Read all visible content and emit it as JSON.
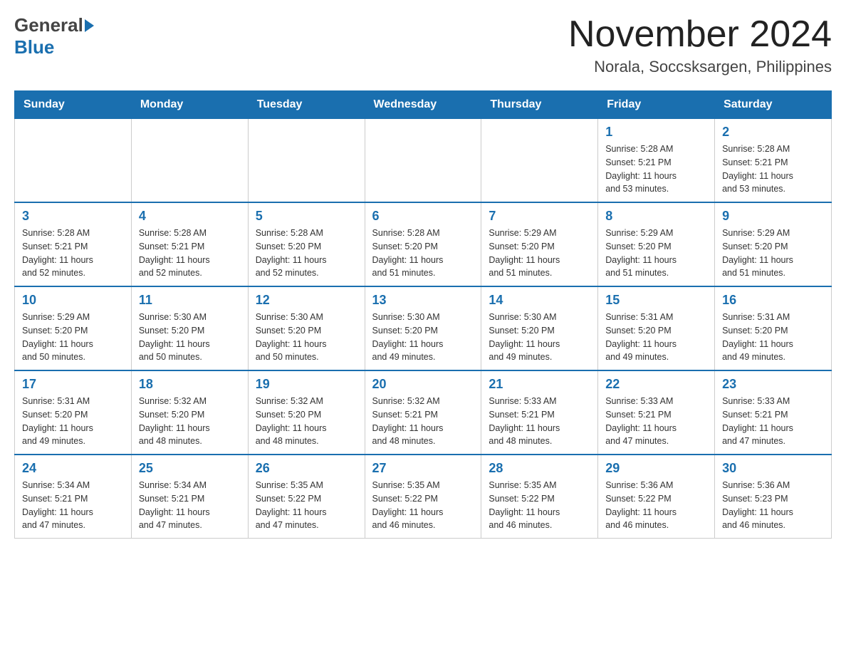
{
  "header": {
    "logo_general": "General",
    "logo_blue": "Blue",
    "title": "November 2024",
    "location": "Norala, Soccsksargen, Philippines"
  },
  "days_of_week": [
    "Sunday",
    "Monday",
    "Tuesday",
    "Wednesday",
    "Thursday",
    "Friday",
    "Saturday"
  ],
  "weeks": [
    {
      "cells": [
        {
          "day": "",
          "info": ""
        },
        {
          "day": "",
          "info": ""
        },
        {
          "day": "",
          "info": ""
        },
        {
          "day": "",
          "info": ""
        },
        {
          "day": "",
          "info": ""
        },
        {
          "day": "1",
          "info": "Sunrise: 5:28 AM\nSunset: 5:21 PM\nDaylight: 11 hours\nand 53 minutes."
        },
        {
          "day": "2",
          "info": "Sunrise: 5:28 AM\nSunset: 5:21 PM\nDaylight: 11 hours\nand 53 minutes."
        }
      ]
    },
    {
      "cells": [
        {
          "day": "3",
          "info": "Sunrise: 5:28 AM\nSunset: 5:21 PM\nDaylight: 11 hours\nand 52 minutes."
        },
        {
          "day": "4",
          "info": "Sunrise: 5:28 AM\nSunset: 5:21 PM\nDaylight: 11 hours\nand 52 minutes."
        },
        {
          "day": "5",
          "info": "Sunrise: 5:28 AM\nSunset: 5:20 PM\nDaylight: 11 hours\nand 52 minutes."
        },
        {
          "day": "6",
          "info": "Sunrise: 5:28 AM\nSunset: 5:20 PM\nDaylight: 11 hours\nand 51 minutes."
        },
        {
          "day": "7",
          "info": "Sunrise: 5:29 AM\nSunset: 5:20 PM\nDaylight: 11 hours\nand 51 minutes."
        },
        {
          "day": "8",
          "info": "Sunrise: 5:29 AM\nSunset: 5:20 PM\nDaylight: 11 hours\nand 51 minutes."
        },
        {
          "day": "9",
          "info": "Sunrise: 5:29 AM\nSunset: 5:20 PM\nDaylight: 11 hours\nand 51 minutes."
        }
      ]
    },
    {
      "cells": [
        {
          "day": "10",
          "info": "Sunrise: 5:29 AM\nSunset: 5:20 PM\nDaylight: 11 hours\nand 50 minutes."
        },
        {
          "day": "11",
          "info": "Sunrise: 5:30 AM\nSunset: 5:20 PM\nDaylight: 11 hours\nand 50 minutes."
        },
        {
          "day": "12",
          "info": "Sunrise: 5:30 AM\nSunset: 5:20 PM\nDaylight: 11 hours\nand 50 minutes."
        },
        {
          "day": "13",
          "info": "Sunrise: 5:30 AM\nSunset: 5:20 PM\nDaylight: 11 hours\nand 49 minutes."
        },
        {
          "day": "14",
          "info": "Sunrise: 5:30 AM\nSunset: 5:20 PM\nDaylight: 11 hours\nand 49 minutes."
        },
        {
          "day": "15",
          "info": "Sunrise: 5:31 AM\nSunset: 5:20 PM\nDaylight: 11 hours\nand 49 minutes."
        },
        {
          "day": "16",
          "info": "Sunrise: 5:31 AM\nSunset: 5:20 PM\nDaylight: 11 hours\nand 49 minutes."
        }
      ]
    },
    {
      "cells": [
        {
          "day": "17",
          "info": "Sunrise: 5:31 AM\nSunset: 5:20 PM\nDaylight: 11 hours\nand 49 minutes."
        },
        {
          "day": "18",
          "info": "Sunrise: 5:32 AM\nSunset: 5:20 PM\nDaylight: 11 hours\nand 48 minutes."
        },
        {
          "day": "19",
          "info": "Sunrise: 5:32 AM\nSunset: 5:20 PM\nDaylight: 11 hours\nand 48 minutes."
        },
        {
          "day": "20",
          "info": "Sunrise: 5:32 AM\nSunset: 5:21 PM\nDaylight: 11 hours\nand 48 minutes."
        },
        {
          "day": "21",
          "info": "Sunrise: 5:33 AM\nSunset: 5:21 PM\nDaylight: 11 hours\nand 48 minutes."
        },
        {
          "day": "22",
          "info": "Sunrise: 5:33 AM\nSunset: 5:21 PM\nDaylight: 11 hours\nand 47 minutes."
        },
        {
          "day": "23",
          "info": "Sunrise: 5:33 AM\nSunset: 5:21 PM\nDaylight: 11 hours\nand 47 minutes."
        }
      ]
    },
    {
      "cells": [
        {
          "day": "24",
          "info": "Sunrise: 5:34 AM\nSunset: 5:21 PM\nDaylight: 11 hours\nand 47 minutes."
        },
        {
          "day": "25",
          "info": "Sunrise: 5:34 AM\nSunset: 5:21 PM\nDaylight: 11 hours\nand 47 minutes."
        },
        {
          "day": "26",
          "info": "Sunrise: 5:35 AM\nSunset: 5:22 PM\nDaylight: 11 hours\nand 47 minutes."
        },
        {
          "day": "27",
          "info": "Sunrise: 5:35 AM\nSunset: 5:22 PM\nDaylight: 11 hours\nand 46 minutes."
        },
        {
          "day": "28",
          "info": "Sunrise: 5:35 AM\nSunset: 5:22 PM\nDaylight: 11 hours\nand 46 minutes."
        },
        {
          "day": "29",
          "info": "Sunrise: 5:36 AM\nSunset: 5:22 PM\nDaylight: 11 hours\nand 46 minutes."
        },
        {
          "day": "30",
          "info": "Sunrise: 5:36 AM\nSunset: 5:23 PM\nDaylight: 11 hours\nand 46 minutes."
        }
      ]
    }
  ]
}
